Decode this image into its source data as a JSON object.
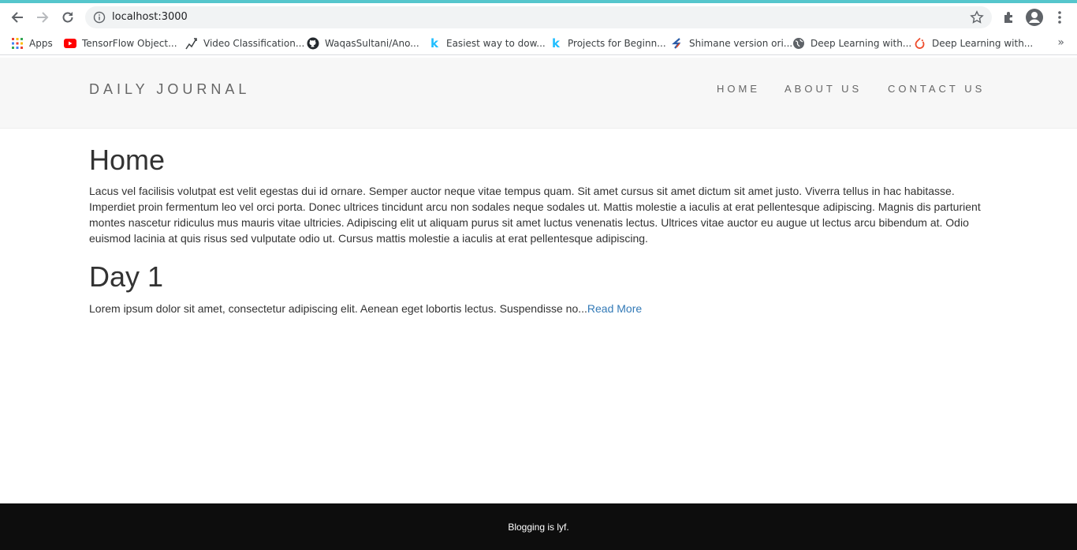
{
  "browser": {
    "url": "localhost:3000",
    "bookmarks": [
      {
        "label": "Apps",
        "icon": "apps-grid-icon"
      },
      {
        "label": "TensorFlow Object...",
        "icon": "youtube-icon"
      },
      {
        "label": "Video Classification...",
        "icon": "chart-trend-icon"
      },
      {
        "label": "WaqasSultani/Ano...",
        "icon": "github-icon"
      },
      {
        "label": "Easiest way to dow...",
        "icon": "kaggle-icon"
      },
      {
        "label": "Projects for Beginn...",
        "icon": "kaggle-icon"
      },
      {
        "label": "Shimane version ori...",
        "icon": "shimane-icon"
      },
      {
        "label": "Deep Learning with...",
        "icon": "globe-icon"
      },
      {
        "label": "Deep Learning with...",
        "icon": "pytorch-icon"
      }
    ],
    "overflow_label": "»"
  },
  "header": {
    "brand": "DAILY JOURNAL",
    "nav": [
      {
        "label": "HOME"
      },
      {
        "label": "ABOUT US"
      },
      {
        "label": "CONTACT US"
      }
    ]
  },
  "main": {
    "title": "Home",
    "intro": "Lacus vel facilisis volutpat est velit egestas dui id ornare. Semper auctor neque vitae tempus quam. Sit amet cursus sit amet dictum sit amet justo. Viverra tellus in hac habitasse. Imperdiet proin fermentum leo vel orci porta. Donec ultrices tincidunt arcu non sodales neque sodales ut. Mattis molestie a iaculis at erat pellentesque adipiscing. Magnis dis parturient montes nascetur ridiculus mus mauris vitae ultricies. Adipiscing elit ut aliquam purus sit amet luctus venenatis lectus. Ultrices vitae auctor eu augue ut lectus arcu bibendum at. Odio euismod lacinia at quis risus sed vulputate odio ut. Cursus mattis molestie a iaculis at erat pellentesque adipiscing.",
    "posts": [
      {
        "title": "Day 1",
        "excerpt": "Lorem ipsum dolor sit amet, consectetur adipiscing elit. Aenean eget lobortis lectus. Suspendisse no...",
        "read_more": "Read More"
      }
    ]
  },
  "footer": {
    "text": "Blogging is lyf."
  },
  "colors": {
    "accent_bar": "#55c6cc",
    "header_bg": "#f7f7f7",
    "link": "#337ab7",
    "footer_bg": "#0d0d0d"
  }
}
